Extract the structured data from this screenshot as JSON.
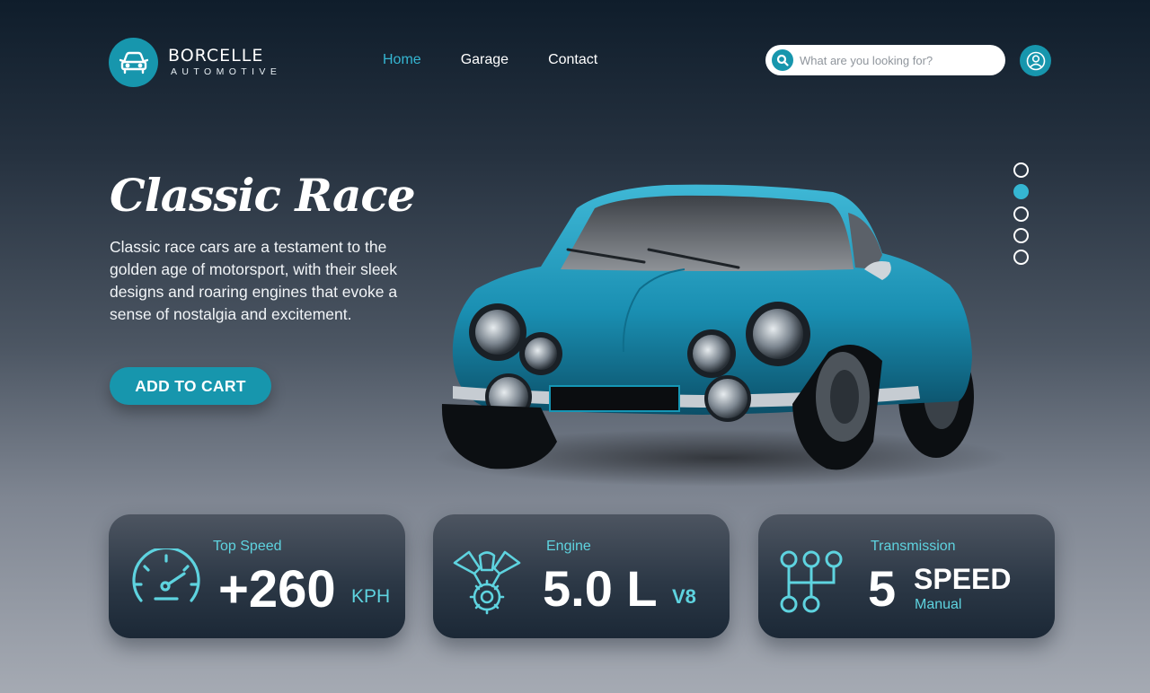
{
  "brand": {
    "name": "BORCELLE",
    "tagline": "AUTOMOTIVE",
    "logo_icon": "car-icon"
  },
  "nav": [
    {
      "label": "Home",
      "active": true
    },
    {
      "label": "Garage",
      "active": false
    },
    {
      "label": "Contact",
      "active": false
    }
  ],
  "search": {
    "placeholder": "What are you looking for?",
    "icon": "search-icon"
  },
  "user": {
    "icon": "user-icon"
  },
  "hero": {
    "title": "Classic Race",
    "description": "Classic race cars are a testament to the golden age of motorsport, with their sleek designs and roaring engines that evoke a sense of nostalgia and excitement.",
    "cta_label": "ADD TO CART"
  },
  "carousel": {
    "count": 5,
    "active_index": 1
  },
  "specs": {
    "speed": {
      "label": "Top Speed",
      "value": "+260",
      "unit": "KPH",
      "icon": "speedometer-icon"
    },
    "engine": {
      "label": "Engine",
      "value": "5.0 L",
      "unit": "V8",
      "icon": "engine-icon"
    },
    "transmission": {
      "label": "Transmission",
      "value": "5",
      "unit": "SPEED",
      "sub": "Manual",
      "icon": "gear-shift-icon"
    }
  },
  "colors": {
    "accent": "#1796ad",
    "accent_light": "#35b6d2",
    "spec_text": "#5ed3df",
    "car_body": "#1b8fb0"
  }
}
